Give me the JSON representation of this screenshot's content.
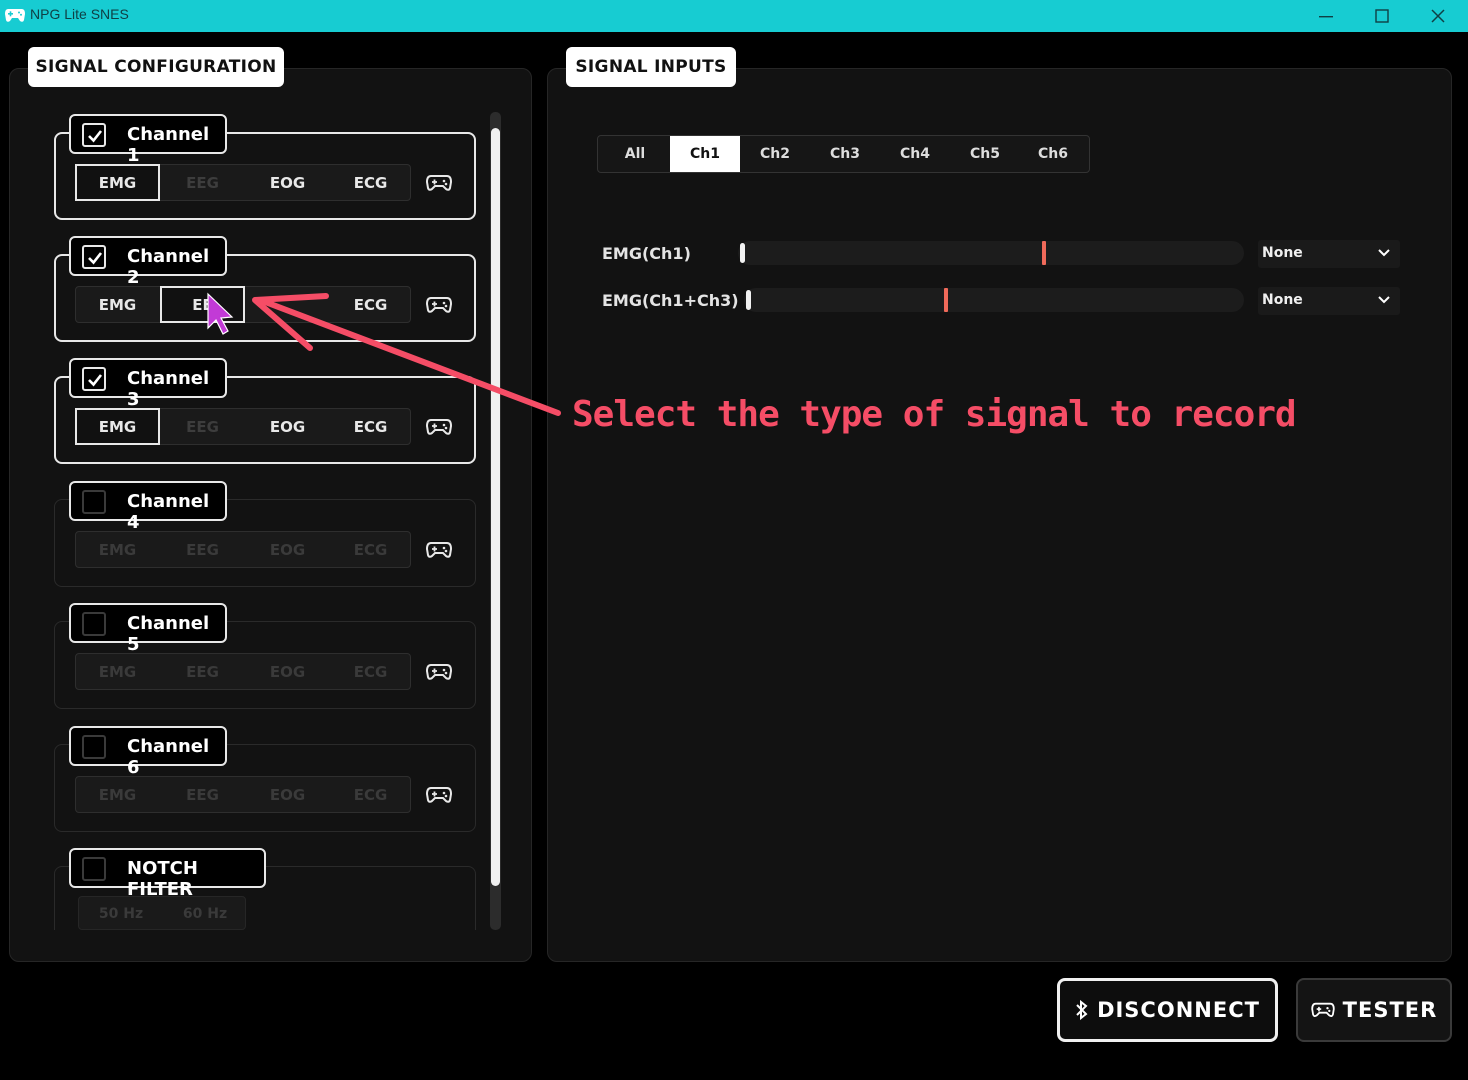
{
  "window": {
    "title": "NPG Lite SNES",
    "minimize": "—",
    "maximize": "☐",
    "close": "✕"
  },
  "config": {
    "title": "SIGNAL CONFIGURATION",
    "signal_types": [
      "EMG",
      "EEG",
      "EOG",
      "ECG"
    ],
    "channels": [
      {
        "name": "Channel 1",
        "checked": true,
        "selected": "EMG"
      },
      {
        "name": "Channel 2",
        "checked": true,
        "selected": "EEG",
        "partial_label": "EE"
      },
      {
        "name": "Channel 3",
        "checked": true,
        "selected": "EMG"
      },
      {
        "name": "Channel 4",
        "checked": false,
        "selected": "EMG"
      },
      {
        "name": "Channel 5",
        "checked": false,
        "selected": "EMG"
      },
      {
        "name": "Channel 6",
        "checked": false,
        "selected": "EMG"
      }
    ],
    "notch": {
      "label": "NOTCH FILTER",
      "checked": false,
      "options": [
        "50 Hz",
        "60 Hz"
      ]
    }
  },
  "inputs": {
    "title": "SIGNAL INPUTS",
    "tabs": [
      "All",
      "Ch1",
      "Ch2",
      "Ch3",
      "Ch4",
      "Ch5",
      "Ch6"
    ],
    "active_tab": "Ch1",
    "signals": [
      {
        "label": "EMG(Ch1)",
        "level": 0.6,
        "mapping": "None"
      },
      {
        "label": "EMG(Ch1+Ch3)",
        "level": 0.4,
        "mapping": "None"
      }
    ]
  },
  "annotation": {
    "text": "Select the type of signal to record",
    "color": "#f54d66"
  },
  "actions": {
    "disconnect": "DISCONNECT",
    "tester": "TESTER"
  },
  "colors": {
    "titlebar": "#17ccd2",
    "accent_marker": "#f06a5a",
    "background": "#000000"
  }
}
